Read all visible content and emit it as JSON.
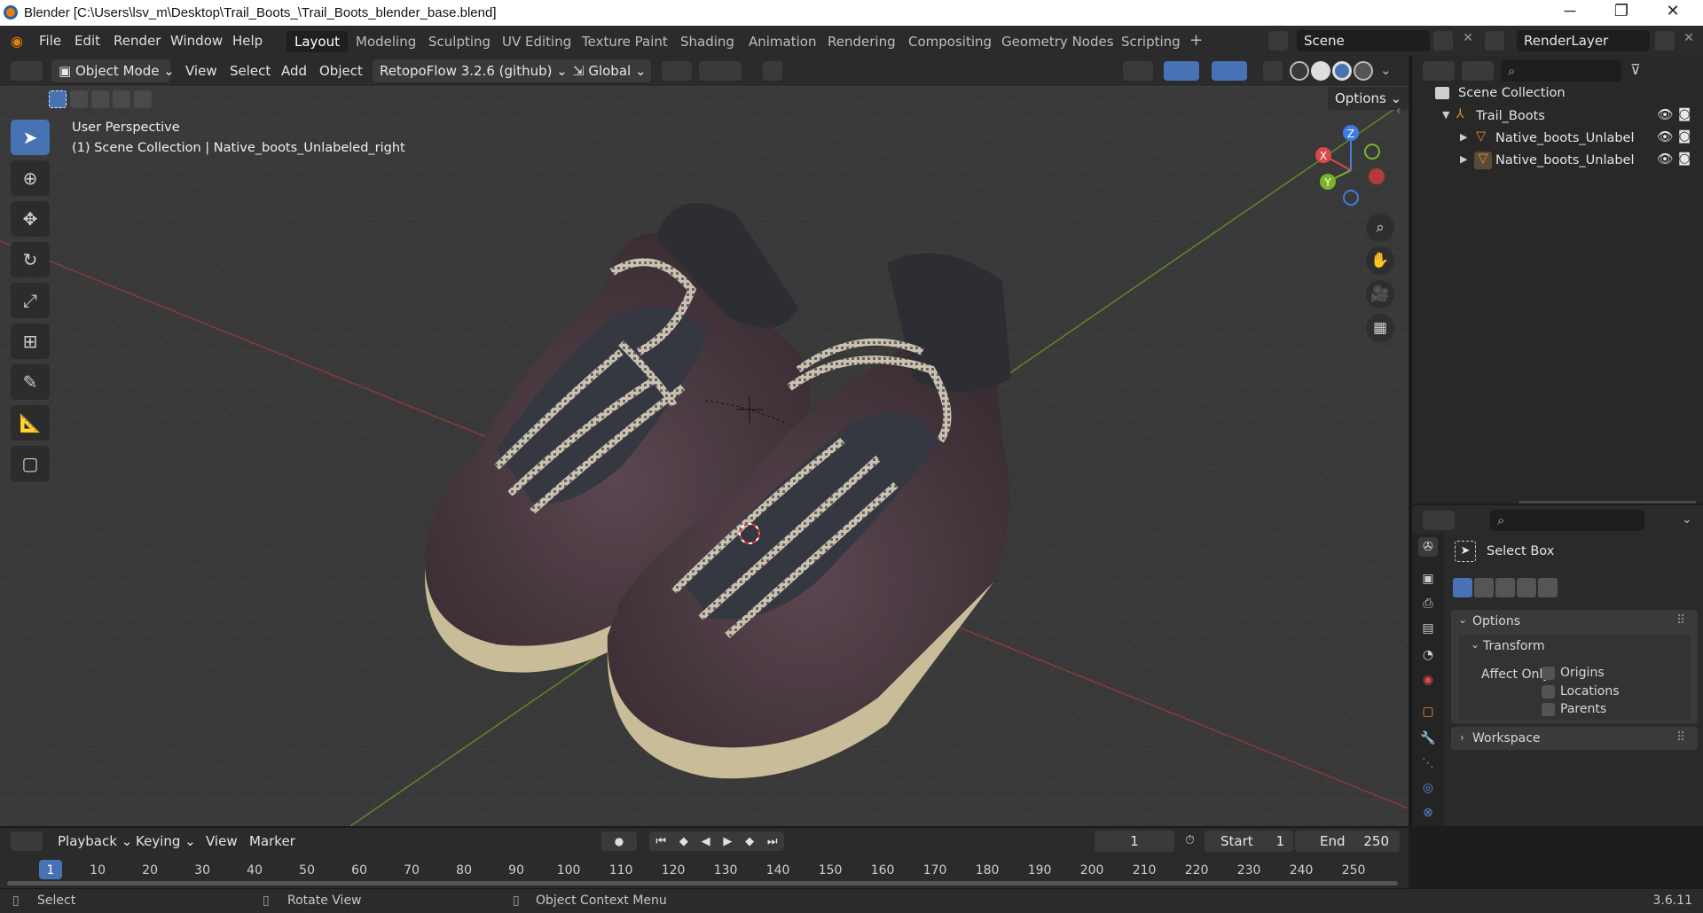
{
  "window": {
    "title": "Blender [C:\\Users\\lsv_m\\Desktop\\Trail_Boots_\\Trail_Boots_blender_base.blend]",
    "minimize": "─",
    "maximize": "❐",
    "close": "✕"
  },
  "menu": [
    "File",
    "Edit",
    "Render",
    "Window",
    "Help"
  ],
  "workspaces": [
    "Layout",
    "Modeling",
    "Sculpting",
    "UV Editing",
    "Texture Paint",
    "Shading",
    "Animation",
    "Rendering",
    "Compositing",
    "Geometry Nodes",
    "Scripting"
  ],
  "active_workspace": "Layout",
  "add_workspace": "+",
  "scene": "Scene",
  "render_layer": "RenderLayer",
  "viewport_header": {
    "mode": "Object Mode",
    "menus": [
      "View",
      "Select",
      "Add",
      "Object"
    ],
    "addon": "RetopoFlow 3.2.6 (github)",
    "orientation": "Global",
    "options": "Options"
  },
  "viewport": {
    "perspective": "User Perspective",
    "context": "(1) Scene Collection | Native_boots_Unlabeled_right",
    "gizmo": {
      "x": "X",
      "y": "Y",
      "z": "Z"
    }
  },
  "outliner": {
    "root": "Scene Collection",
    "items": [
      {
        "name": "Trail_Boots"
      },
      {
        "name": "Native_boots_Unlabel"
      },
      {
        "name": "Native_boots_Unlabel"
      }
    ]
  },
  "properties": {
    "tool_name": "Select Box",
    "options": "Options",
    "transform": "Transform",
    "affect_only": "Affect Only",
    "checkboxes": [
      "Origins",
      "Locations",
      "Parents"
    ],
    "workspace": "Workspace"
  },
  "timeline": {
    "menus": [
      "Playback",
      "Keying",
      "View",
      "Marker"
    ],
    "current_frame": "1",
    "start_label": "Start",
    "start": "1",
    "end_label": "End",
    "end": "250",
    "frames": [
      "1",
      "10",
      "20",
      "30",
      "40",
      "50",
      "60",
      "70",
      "80",
      "90",
      "100",
      "110",
      "120",
      "130",
      "140",
      "150",
      "160",
      "170",
      "180",
      "190",
      "200",
      "210",
      "220",
      "230",
      "240",
      "250"
    ]
  },
  "status": {
    "select": "Select",
    "rotate": "Rotate View",
    "context_menu": "Object Context Menu",
    "version": "3.6.11"
  },
  "colors": {
    "accent": "#4772b3",
    "header": "#2b2b2b",
    "viewport": "#3a3a3a"
  }
}
